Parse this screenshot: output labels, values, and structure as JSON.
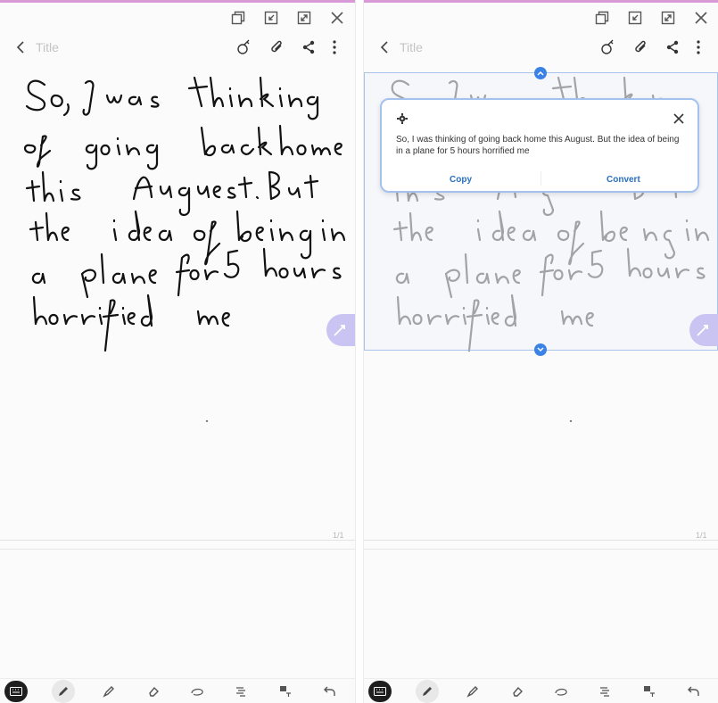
{
  "left": {
    "title_placeholder": "Title",
    "page_number": "1/1"
  },
  "right": {
    "title_placeholder": "Title",
    "page_number": "1/1",
    "popup": {
      "recognized_text": "So, I was thinking of going back home this August. But the idea of being in a plane for 5 hours horrified me",
      "copy_label": "Copy",
      "convert_label": "Convert"
    }
  },
  "icons": {
    "window": [
      "popup-view-icon",
      "minimize-icon",
      "expand-icon",
      "close-icon"
    ],
    "appbar": [
      "back-icon",
      "handwriting-icon",
      "attach-icon",
      "share-icon",
      "more-icon"
    ],
    "toolbar": [
      "keyboard-icon",
      "pen-icon",
      "highlighter-icon",
      "eraser-icon",
      "lasso-icon",
      "text-style-icon",
      "shape-text-icon",
      "undo-icon"
    ]
  },
  "colors": {
    "accent": "#3b82e6",
    "action_text": "#2a6fbd",
    "fab": "#c9c4f2",
    "selection_border": "#a9c4ea"
  }
}
